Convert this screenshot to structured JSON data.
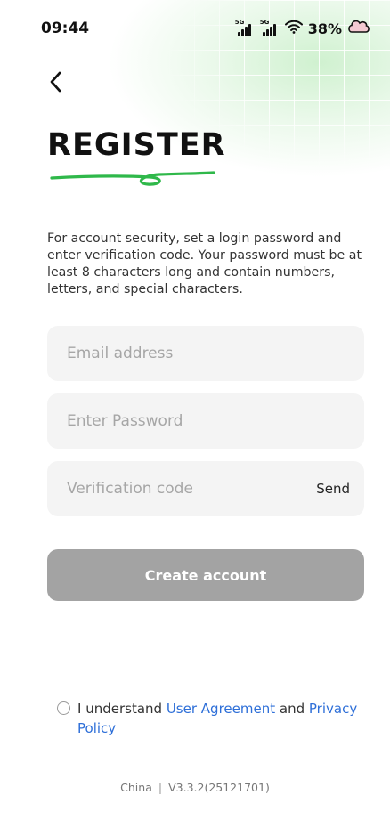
{
  "status_bar": {
    "time": "09:44",
    "signal1_tag": "5G",
    "signal2_tag": "5G",
    "battery": "38%"
  },
  "header": {
    "title": "REGISTER"
  },
  "description": "For account security, set a login password and enter verification code. Your password must be at least 8 characters long and contain numbers, letters, and special characters.",
  "form": {
    "email_placeholder": "Email address",
    "email_value": "",
    "password_placeholder": "Enter Password",
    "password_value": "",
    "code_placeholder": "Verification code",
    "code_value": "",
    "send_label": "Send",
    "submit_label": "Create account"
  },
  "agreement": {
    "prefix": "I understand",
    "user_agreement_link": "User Agreement",
    "connector": "and",
    "privacy_policy_link": "Privacy Policy",
    "checked": false
  },
  "footer": {
    "region": "China",
    "separator": "|",
    "version": "V3.3.2(25121701)"
  },
  "colors": {
    "accent_green": "#2fb84a",
    "link_blue": "#2e6fd8",
    "button_disabled": "#a3a3a3",
    "field_background": "#f4f4f4"
  },
  "icons": {
    "back": "chevron-left-icon",
    "wifi": "wifi-icon",
    "battery": "battery-icon",
    "signal": "cellular-signal-icon",
    "radio": "radio-unchecked-icon"
  }
}
